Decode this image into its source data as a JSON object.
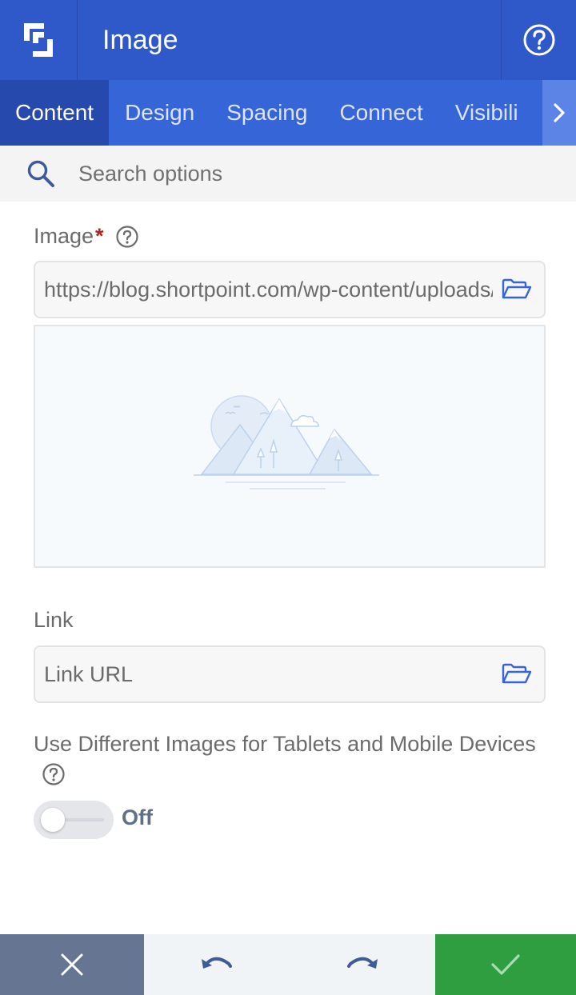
{
  "header": {
    "title": "Image",
    "logo_icon": "shortpoint-logo-icon",
    "help_icon": "help-circle-icon"
  },
  "tabs": [
    {
      "label": "Content",
      "active": true
    },
    {
      "label": "Design",
      "active": false
    },
    {
      "label": "Spacing",
      "active": false
    },
    {
      "label": "Connect",
      "active": false
    },
    {
      "label": "Visibili",
      "active": false
    }
  ],
  "search": {
    "placeholder": "Search options"
  },
  "image_field": {
    "label": "Image",
    "required_mark": "*",
    "value": "https://blog.shortpoint.com/wp-content/uploads/"
  },
  "link_field": {
    "label": "Link",
    "placeholder": "Link URL"
  },
  "responsive_images": {
    "label": "Use Different Images for Tablets and Mobile Devices",
    "toggle_state": "Off"
  },
  "footer": {
    "cancel_icon": "close-icon",
    "undo_icon": "undo-icon",
    "redo_icon": "redo-icon",
    "save_icon": "check-icon"
  },
  "colors": {
    "header_bg": "#2f58c9",
    "tabs_bg": "#3665d8",
    "active_tab_bg": "#2549ad",
    "cancel_bg": "#667692",
    "save_bg": "#2e9e40",
    "required": "#b22222"
  }
}
